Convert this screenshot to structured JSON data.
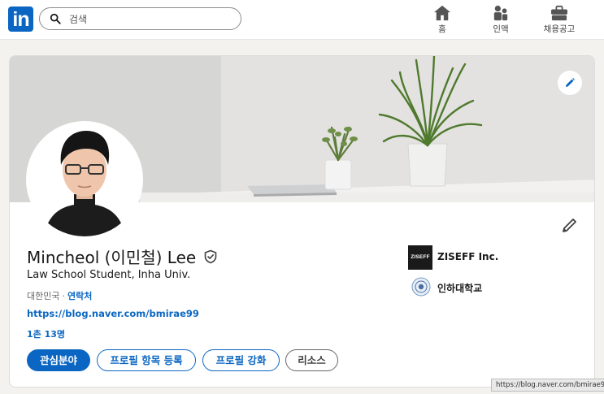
{
  "nav": {
    "search_placeholder": "검색",
    "items": [
      {
        "label": "홈",
        "icon": "home-icon"
      },
      {
        "label": "인맥",
        "icon": "people-icon"
      },
      {
        "label": "채용공고",
        "icon": "briefcase-icon"
      }
    ]
  },
  "profile": {
    "name": "Mincheol (이민철) Lee",
    "headline": "Law School Student, Inha Univ.",
    "location": "대한민국",
    "separator": "·",
    "contact_label": "연락처",
    "website": "https://blog.naver.com/bmirae99",
    "connections": "1촌 13명",
    "buttons": {
      "open_to": "관심분야",
      "add_section": "프로필 항목 등록",
      "enhance": "프로필 강화",
      "resources": "리소스"
    },
    "experience": [
      {
        "name": "ZISEFF Inc.",
        "logo_text": "ZISEFF"
      },
      {
        "name": "인하대학교"
      }
    ]
  },
  "status_url": "https://blog.naver.com/bmirae99",
  "colors": {
    "brand": "#0a66c2",
    "background": "#f4f2ee",
    "card": "#ffffff"
  }
}
